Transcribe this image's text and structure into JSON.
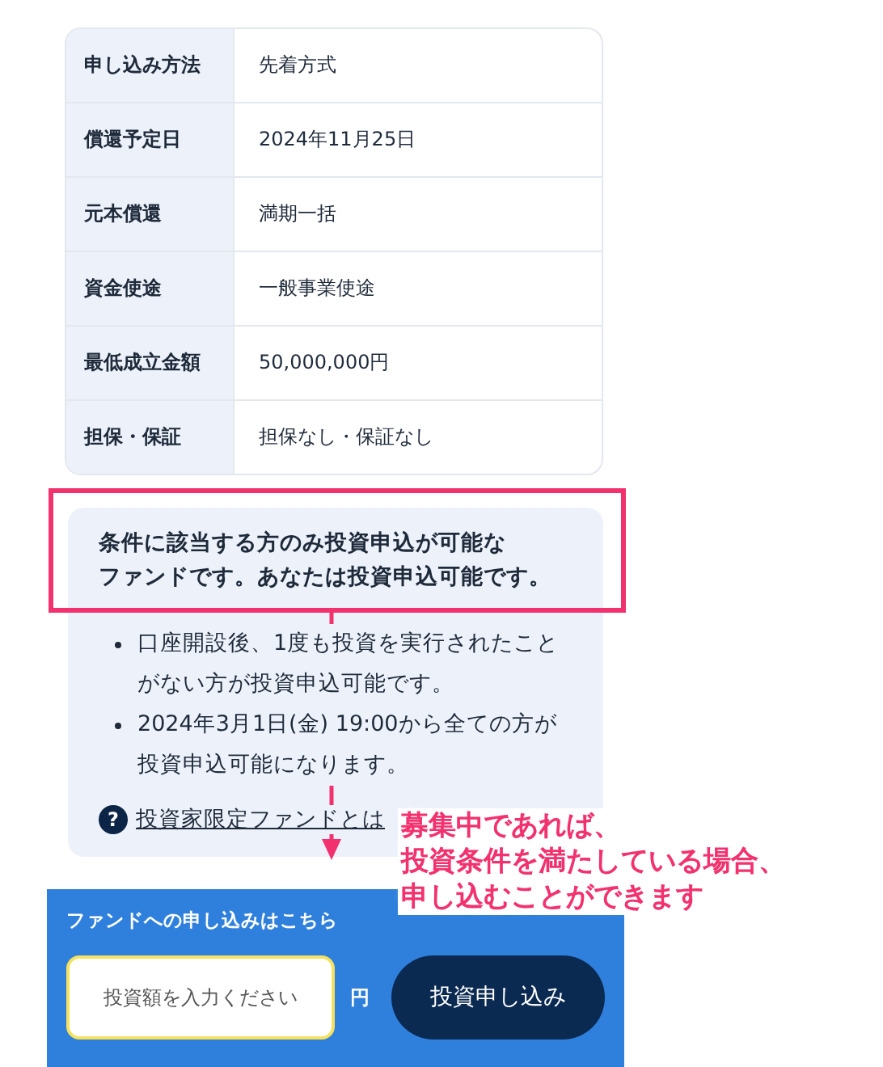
{
  "table": {
    "rows": [
      {
        "label": "申し込み方法",
        "value": "先着方式"
      },
      {
        "label": "償還予定日",
        "value": "2024年11月25日"
      },
      {
        "label": "元本償還",
        "value": "満期一括"
      },
      {
        "label": "資金使途",
        "value": "一般事業使途"
      },
      {
        "label": "最低成立金額",
        "value": "50,000,000円"
      },
      {
        "label": "担保・保証",
        "value": "担保なし・保証なし"
      }
    ]
  },
  "notice": {
    "heading_lines": [
      "条件に該当する方のみ投資申込が可能な",
      "ファンドです。あなたは投資申込可能です。"
    ],
    "bullets": [
      "口座開設後、1度も投資を実行されたことがない方が投資申込可能です。",
      "2024年3月1日(金) 19:00から全ての方が投資申込可能になります。"
    ],
    "help_icon": "?",
    "link": "投資家限定ファンドとは"
  },
  "apply": {
    "title": "ファンドへの申し込みはこちら",
    "amount_field": {
      "placeholder": "投資額を入力ください"
    },
    "unit": "円",
    "button": "投資申し込み"
  },
  "annotation": {
    "callout_lines": [
      "募集中であれば、",
      "投資条件を満たしている場合、",
      "申し込むことができます"
    ]
  }
}
